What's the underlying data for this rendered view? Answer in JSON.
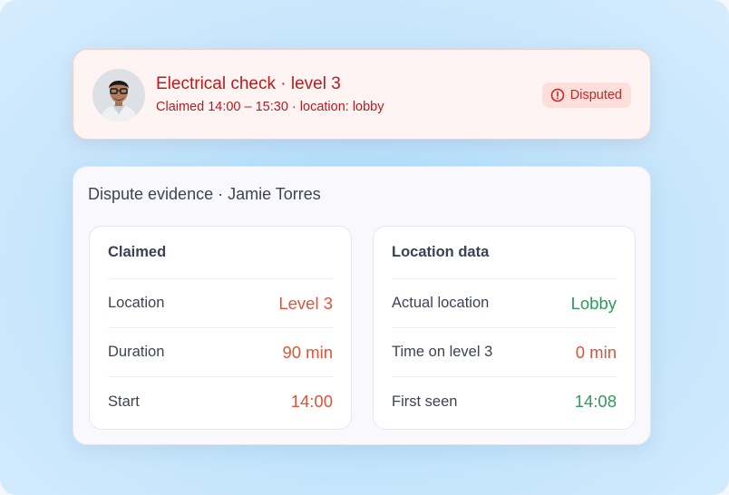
{
  "alert": {
    "title": "Electrical check · level 3",
    "subtitle": "Claimed 14:00 – 15:30 · location: lobby",
    "status": "Disputed",
    "status_icon": "alert-circle-icon",
    "colors": {
      "text": "#b71c1c",
      "badge_bg": "#fcdedb",
      "card_bg": "#fef4f3"
    }
  },
  "evidence": {
    "title": "Dispute evidence · Jamie Torres",
    "claimed": {
      "heading": "Claimed",
      "rows": [
        {
          "label": "Location",
          "value": "Level 3"
        },
        {
          "label": "Duration",
          "value": "90 min"
        },
        {
          "label": "Start",
          "value": "14:00"
        }
      ],
      "value_color": "#e0533a"
    },
    "location_data": {
      "heading": "Location data",
      "rows": [
        {
          "label": "Actual location",
          "value": "Lobby"
        },
        {
          "label": "Time on level 3",
          "value": "0 min"
        },
        {
          "label": "First seen",
          "value": "14:08"
        }
      ],
      "value_colors": [
        "#2f9a5a",
        "#e0533a",
        "#2f9a5a"
      ]
    }
  }
}
